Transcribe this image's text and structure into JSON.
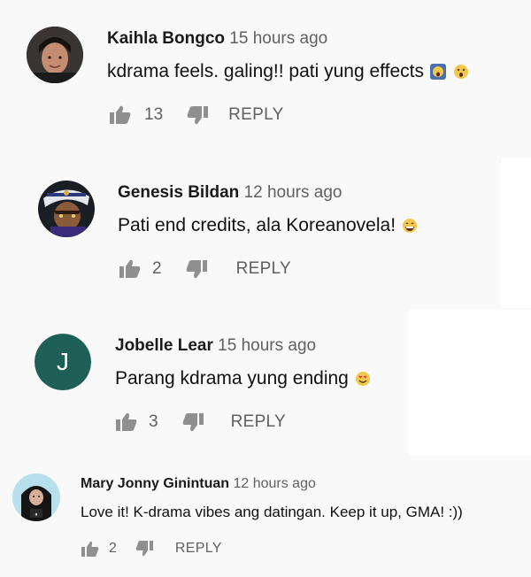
{
  "comments": [
    {
      "author": "Kaihla Bongco",
      "time": "15 hours ago",
      "text": "kdrama feels. galing!! pati yung effects",
      "emojis": [
        "screaming-face-emoji",
        "astonished-face-emoji"
      ],
      "likes": "13",
      "reply_label": "REPLY",
      "avatar": "photo"
    },
    {
      "author": "Genesis Bildan",
      "time": "12 hours ago",
      "text": "Pati end credits, ala Koreanovela!",
      "emojis": [
        "grinning-face-emoji"
      ],
      "likes": "2",
      "reply_label": "REPLY",
      "avatar": "photo"
    },
    {
      "author": "Jobelle Lear",
      "time": "15 hours ago",
      "text": "Parang kdrama yung ending",
      "emojis": [
        "smiling-face-heart-eyes-emoji"
      ],
      "likes": "3",
      "reply_label": "REPLY",
      "avatar_letter": "J",
      "avatar_color": "#1e5f57"
    },
    {
      "author": "Mary Jonny Ginintuan",
      "time": "12 hours ago",
      "text": "Love it! K-drama vibes ang datingan. Keep it up, GMA! :))",
      "emojis": [],
      "likes": "2",
      "reply_label": "REPLY",
      "avatar": "photo"
    }
  ]
}
